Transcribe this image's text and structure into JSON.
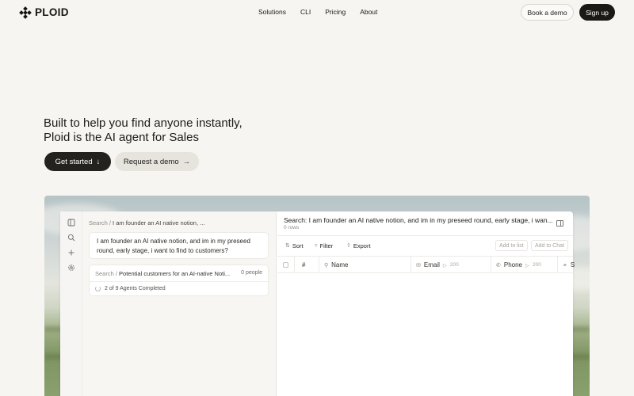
{
  "nav": {
    "logo_text": "PLOID",
    "links": [
      "Solutions",
      "CLI",
      "Pricing",
      "About"
    ],
    "book_demo": "Book a demo",
    "sign_up": "Sign up"
  },
  "hero": {
    "title_line1": "Built to help you find anyone instantly,",
    "title_line2": "Ploid is the AI agent for Sales",
    "cta_primary": "Get started",
    "cta_primary_icon": "↓",
    "cta_secondary": "Request a demo",
    "cta_secondary_icon": "→"
  },
  "app": {
    "chat": {
      "crumb_root": "Search",
      "crumb_sep": "/",
      "crumb_current": "I am founder an AI native notion, ...",
      "message": "I am founder an AI native notion, and im in my preseed round, early stage, i want to find to customers?",
      "task_root": "Search",
      "task_sep": "/",
      "task_title": "Potential customers for an AI-native Noti...",
      "task_count": "0 people",
      "task_status": "2 of 9 Agents Completed"
    },
    "table": {
      "title": "Search: I am founder an AI native notion, and im in my preseed round, early stage, i wan...",
      "rows": "0 rows",
      "toolbar": {
        "sort": "Sort",
        "filter": "Filter",
        "export": "Export",
        "add_list": "Add to list",
        "add_chat": "Add to Chat"
      },
      "columns": {
        "num": "#",
        "name": "Name",
        "email": "Email",
        "email_count": "200",
        "phone": "Phone",
        "phone_count": "200",
        "extra": "S"
      }
    }
  },
  "colors": {
    "background": "#f7f5f1",
    "primary_button": "#23221e",
    "secondary_button": "#e7e4de"
  }
}
